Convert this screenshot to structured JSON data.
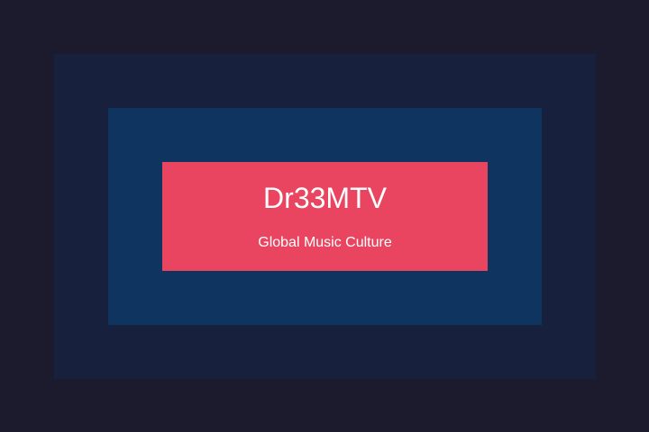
{
  "brand": {
    "name": "Dr33MTV",
    "tagline": "Global Music Culture"
  },
  "colors": {
    "background": "#1b1b2d",
    "outer_frame": "#17203d",
    "inner_frame": "#0f3460",
    "accent": "#e94560",
    "text": "#ffffff"
  }
}
